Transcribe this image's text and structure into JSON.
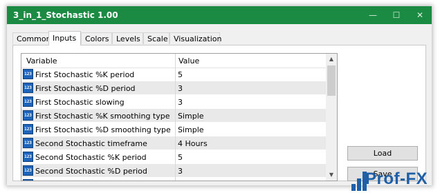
{
  "window": {
    "title": "3_in_1_Stochastic 1.00",
    "min_glyph": "—",
    "max_glyph": "☐",
    "close_glyph": "✕"
  },
  "tabs": [
    {
      "label": "Common"
    },
    {
      "label": "Inputs",
      "active": true
    },
    {
      "label": "Colors"
    },
    {
      "label": "Levels"
    },
    {
      "label": "Scale"
    },
    {
      "label": "Visualization"
    }
  ],
  "grid": {
    "headers": {
      "variable": "Variable",
      "value": "Value"
    },
    "icon_text": "123",
    "rows": [
      {
        "name": "First Stochastic %K period",
        "value": "5"
      },
      {
        "name": "First Stochastic %D period",
        "value": "3"
      },
      {
        "name": "First Stochastic slowing",
        "value": "3"
      },
      {
        "name": "First Stochastic %K smoothing type",
        "value": "Simple"
      },
      {
        "name": "First Stochastic %D smoothing type",
        "value": "Simple"
      },
      {
        "name": "Second Stochastic timeframe",
        "value": "4 Hours"
      },
      {
        "name": "Second Stochastic %K period",
        "value": "5"
      },
      {
        "name": "Second Stochastic %D period",
        "value": "3"
      }
    ]
  },
  "buttons": {
    "load": "Load",
    "save": "Save"
  },
  "watermark": {
    "text": "Prof-FX"
  },
  "colors": {
    "titlebar": "#1b8a43",
    "alt_row": "#e9e9e9",
    "logo": "#1f5fa8"
  }
}
